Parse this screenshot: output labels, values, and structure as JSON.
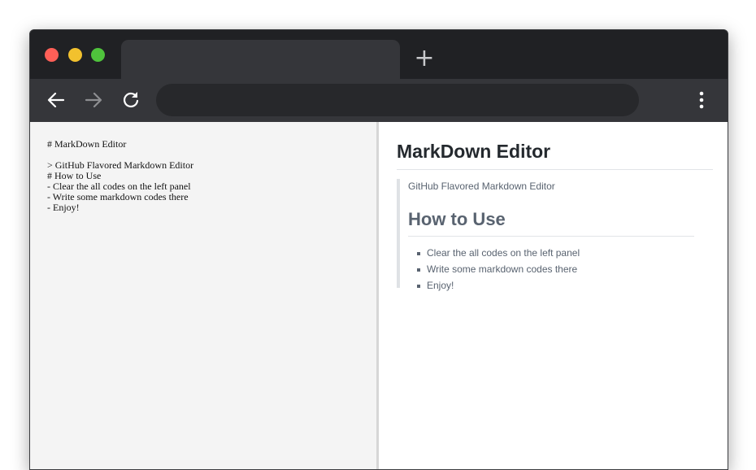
{
  "window": {
    "controls": [
      {
        "name": "close",
        "color": "#ff5f57"
      },
      {
        "name": "minimize",
        "color": "#f2c12e"
      },
      {
        "name": "maximize",
        "color": "#4fc33c"
      }
    ],
    "tab_title": "",
    "new_tab_label": "+"
  },
  "toolbar": {
    "back_icon": "arrow-left-icon",
    "forward_icon": "arrow-right-icon",
    "reload_icon": "reload-icon",
    "address_value": "",
    "menu_icon": "kebab-menu-icon"
  },
  "editor": {
    "lines": [
      "# MarkDown Editor",
      "",
      "> GitHub Flavored Markdown Editor",
      "# How to Use",
      "- Clear the all codes on the left panel",
      "- Write some markdown codes there",
      "- Enjoy!"
    ]
  },
  "preview": {
    "title": "MarkDown Editor",
    "quote_text": "GitHub Flavored Markdown Editor",
    "subtitle": "How to Use",
    "items": [
      "Clear the all codes on the left panel",
      "Write some markdown codes there",
      "Enjoy!"
    ]
  },
  "colors": {
    "titlebar": "#202124",
    "toolbar": "#35363a",
    "editor_bg": "#f4f4f4",
    "preview_bg": "#ffffff"
  }
}
